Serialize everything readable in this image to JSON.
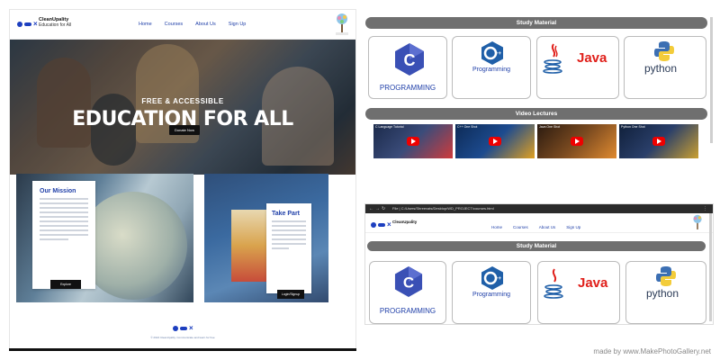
{
  "home": {
    "brand_name": "CleanUpality",
    "brand_tagline": "Education for All",
    "nav": [
      "Home",
      "Courses",
      "About Us",
      "Sign Up"
    ],
    "hero_sub": "FREE & ACCESSIBLE",
    "hero_title": "EDUCATION FOR ALL",
    "hero_button": "Donate Now",
    "mission_title": "Our Mission",
    "mission_button": "Explore",
    "takepart_title": "Take Part",
    "takepart_button": "Login/Signup",
    "footer": "© 2024 CleanUpality. Communicate and learn for free"
  },
  "courses": {
    "study_title": "Study Material",
    "video_title": "Video Lectures",
    "cards": [
      {
        "label": "PROGRAMMING",
        "icon": "c-language-icon"
      },
      {
        "label": "Programming",
        "icon": "cpp-language-icon"
      },
      {
        "label": "Java",
        "icon": "java-icon"
      },
      {
        "label": "python",
        "icon": "python-icon"
      }
    ],
    "videos": [
      {
        "caption": "C Language Tutorial"
      },
      {
        "caption": "C++ One Shot"
      },
      {
        "caption": "Java One Shot"
      },
      {
        "caption": "Python One Shot"
      }
    ]
  },
  "browser": {
    "url": "File | C:/Users/Shreevats/Desktop/WD_PROJECT/courses.html",
    "brand_name": "CleanUpality",
    "nav": [
      "Home",
      "Courses",
      "About Us",
      "Sign Up"
    ],
    "study_title": "Study Material"
  },
  "watermark": "made by www.MakePhotoGallery.net",
  "colors": {
    "accent": "#1f3fa8",
    "bar": "#6f6f6f",
    "java": "#e0201b"
  }
}
